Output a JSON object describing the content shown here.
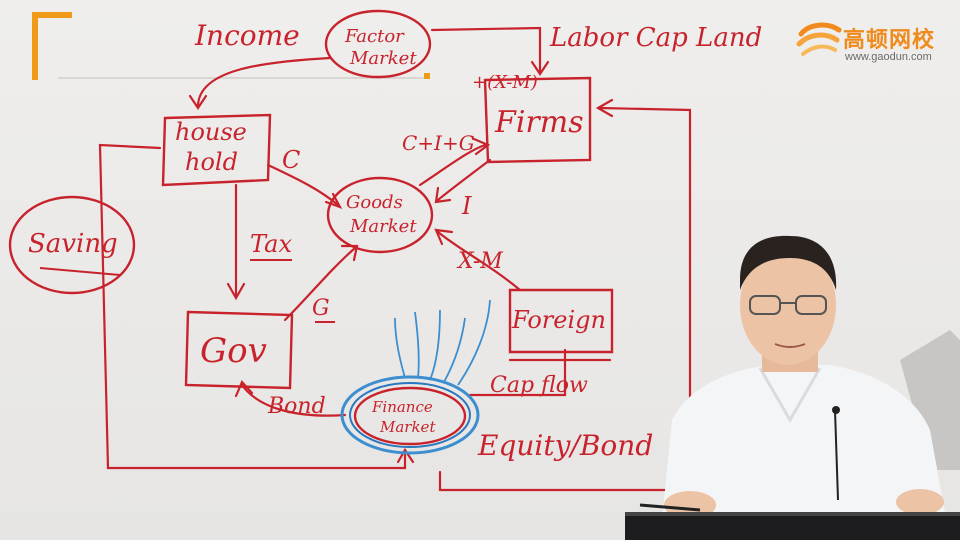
{
  "logo": {
    "name": "高顿网校",
    "url": "www.gaodun.com",
    "color": "#f08a1c"
  },
  "ink_color": "#c8232c",
  "swirl_color": "#3b8fd0",
  "diagram": {
    "income": "Income",
    "factor_market": [
      "Factor",
      "Market"
    ],
    "labor_cap_land": "Labor Cap Land",
    "household": [
      "house",
      "hold"
    ],
    "c_label": "C",
    "firms": "Firms",
    "c_i_g": "C+I+G",
    "x_m": "+(X-M)",
    "goods_market": [
      "Goods",
      "Market"
    ],
    "i_label": "I",
    "x_label": "X-M",
    "tax": "Tax",
    "saving": "Saving",
    "gov": "Gov",
    "g_label": "G",
    "foreign": "Foreign",
    "cap_flow": "Cap flow",
    "finance_market": [
      "Finance",
      "Market"
    ],
    "bond": "Bond",
    "equity_bond": "Equity/Bond"
  }
}
